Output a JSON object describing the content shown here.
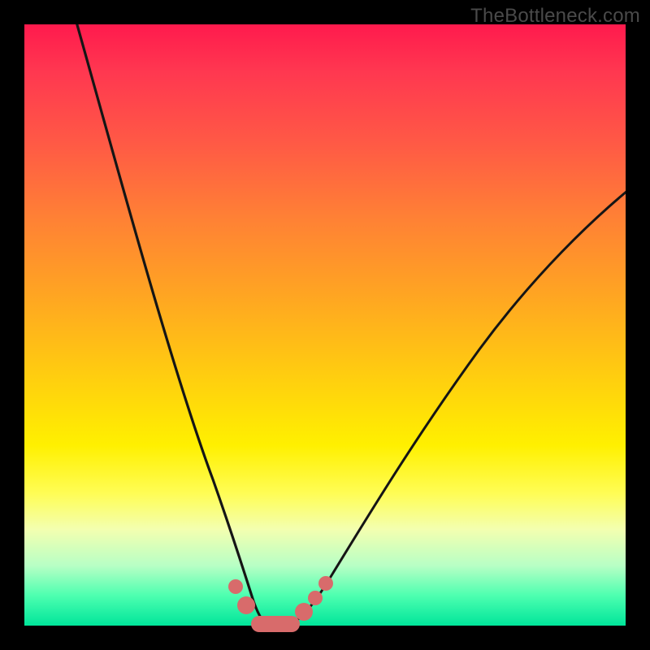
{
  "watermark": "TheBottleneck.com",
  "chart_data": {
    "type": "line",
    "title": "",
    "xlabel": "",
    "ylabel": "",
    "xlim": [
      0,
      100
    ],
    "ylim": [
      0,
      100
    ],
    "grid": false,
    "legend": false,
    "series": [
      {
        "name": "left-branch",
        "x": [
          8,
          12,
          16,
          20,
          24,
          28,
          31,
          33,
          35,
          36.5,
          38
        ],
        "y": [
          100,
          84,
          68,
          53,
          38,
          24,
          13,
          7,
          3,
          1,
          0
        ]
      },
      {
        "name": "right-branch",
        "x": [
          44,
          46,
          48,
          51,
          55,
          60,
          66,
          73,
          82,
          92,
          100
        ],
        "y": [
          0,
          1,
          3,
          6,
          11,
          18,
          27,
          37,
          50,
          63,
          72
        ]
      }
    ],
    "markers": [
      {
        "x": 33.5,
        "y": 6,
        "name": "left-dot-upper"
      },
      {
        "x": 35.5,
        "y": 2.5,
        "name": "left-dot-lower"
      },
      {
        "x": 46,
        "y": 2,
        "name": "right-dot-1"
      },
      {
        "x": 48,
        "y": 4.5,
        "name": "right-dot-2"
      },
      {
        "x": 50,
        "y": 7,
        "name": "right-dot-3"
      }
    ],
    "flat_segment": {
      "x_start": 37,
      "x_end": 44,
      "y": 0
    },
    "background_gradient": {
      "top": "#ff1a4d",
      "mid": "#fff000",
      "bottom": "#00e59a"
    }
  }
}
